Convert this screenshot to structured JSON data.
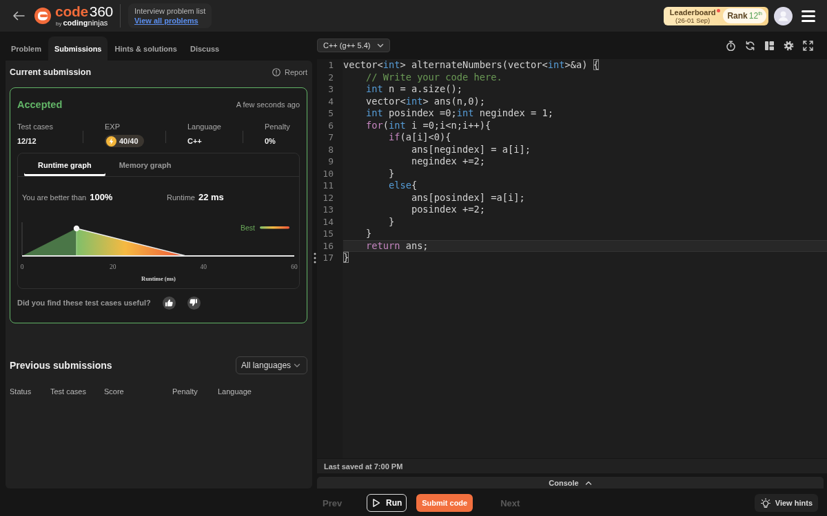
{
  "header": {
    "logo": {
      "accent": "code",
      "number": "360",
      "by": "by",
      "brand": "**coding**ninjas"
    },
    "breadcrumb": {
      "title": "Interview problem list",
      "link": "View all problems"
    },
    "leaderboard": {
      "label": "Leaderboard",
      "period": "(26-01 Sep)",
      "unread": true,
      "rank_label": "Rank",
      "rank": "12$^{th}$"
    }
  },
  "tabs": [
    {
      "label": "Problem",
      "selected": false
    },
    {
      "label": "Submissions",
      "selected": true
    },
    {
      "label": "Hints & solutions",
      "selected": false
    },
    {
      "label": "Discuss",
      "selected": false
    }
  ],
  "submission": {
    "title": "Current submission",
    "report": "Report",
    "result": {
      "status": "Accepted",
      "kind": "accepted",
      "time": "A few seconds ago",
      "stats": [
        {
          "label": "Test cases",
          "value": "12/12",
          "kind": "text"
        },
        {
          "label": "EXP",
          "value": "40/40",
          "kind": "exp"
        },
        {
          "label": "Language",
          "value": "C++",
          "kind": "text"
        },
        {
          "label": "Penalty",
          "value": "0%",
          "kind": "text"
        }
      ],
      "graph": {
        "tabs": [
          {
            "label": "Runtime graph",
            "selected": true
          },
          {
            "label": "Memory graph",
            "selected": false
          }
        ],
        "better_label": "You are better than",
        "better_value": "100%",
        "runtime_label": "Runtime",
        "runtime_value": "22 ms",
        "legend": "Best",
        "x_ticks": [
          "0",
          "20",
          "40",
          "60"
        ],
        "x_label": "Runtime (ms)"
      },
      "feedback": "Did you find these test cases useful?"
    }
  },
  "previous": {
    "title": "Previous submissions",
    "filter": "All languages",
    "columns": [
      "Status",
      "Test cases",
      "Score",
      "Penalty",
      "Language"
    ]
  },
  "editor": {
    "language": "C++ (g++ 5.4)",
    "lines": [
      {
        "number": "1",
        "current": false,
        "tokens": [
          {
            "text": "vector<",
            "kind": "plain"
          },
          {
            "text": "int",
            "kind": "type"
          },
          {
            "text": "> alternateNumbers(vector<",
            "kind": "plain"
          },
          {
            "text": "int",
            "kind": "type"
          },
          {
            "text": ">&a) ",
            "kind": "plain"
          },
          {
            "text": "{",
            "kind": "bracket"
          }
        ]
      },
      {
        "number": "2",
        "current": false,
        "tokens": [
          {
            "text": "    // Write your code here.",
            "kind": "comment"
          }
        ]
      },
      {
        "number": "3",
        "current": false,
        "tokens": [
          {
            "text": "    int",
            "kind": "type"
          },
          {
            "text": " n = a.size();",
            "kind": "plain"
          }
        ]
      },
      {
        "number": "4",
        "current": false,
        "tokens": [
          {
            "text": "    vector<",
            "kind": "plain"
          },
          {
            "text": "int",
            "kind": "type"
          },
          {
            "text": "> ans(n,0);",
            "kind": "plain"
          }
        ]
      },
      {
        "number": "5",
        "current": false,
        "tokens": [
          {
            "text": "    int",
            "kind": "type"
          },
          {
            "text": " posindex =0;",
            "kind": "plain"
          },
          {
            "text": "int",
            "kind": "type"
          },
          {
            "text": " negindex = 1;",
            "kind": "plain"
          }
        ]
      },
      {
        "number": "6",
        "current": false,
        "tokens": [
          {
            "text": "    for",
            "kind": "control"
          },
          {
            "text": "(",
            "kind": "plain"
          },
          {
            "text": "int",
            "kind": "type"
          },
          {
            "text": " i =0;i<n;i++){",
            "kind": "plain"
          }
        ]
      },
      {
        "number": "7",
        "current": false,
        "tokens": [
          {
            "text": "        if",
            "kind": "control"
          },
          {
            "text": "(a[i]<0){",
            "kind": "plain"
          }
        ]
      },
      {
        "number": "8",
        "current": false,
        "tokens": [
          {
            "text": "            ans[negindex] = a[i];",
            "kind": "plain"
          }
        ]
      },
      {
        "number": "9",
        "current": false,
        "tokens": [
          {
            "text": "            negindex +=2;",
            "kind": "plain"
          }
        ]
      },
      {
        "number": "10",
        "current": false,
        "tokens": [
          {
            "text": "        }",
            "kind": "plain"
          }
        ]
      },
      {
        "number": "11",
        "current": false,
        "tokens": [
          {
            "text": "        else",
            "kind": "type"
          },
          {
            "text": "{",
            "kind": "plain"
          }
        ]
      },
      {
        "number": "12",
        "current": false,
        "tokens": [
          {
            "text": "            ans[posindex] =a[i];",
            "kind": "plain"
          }
        ]
      },
      {
        "number": "13",
        "current": false,
        "tokens": [
          {
            "text": "            posindex +=2;",
            "kind": "plain"
          }
        ]
      },
      {
        "number": "14",
        "current": false,
        "tokens": [
          {
            "text": "        }",
            "kind": "plain"
          }
        ]
      },
      {
        "number": "15",
        "current": false,
        "tokens": [
          {
            "text": "    }",
            "kind": "plain"
          }
        ]
      },
      {
        "number": "16",
        "current": true,
        "tokens": [
          {
            "text": "    return",
            "kind": "control"
          },
          {
            "text": " ans;",
            "kind": "plain"
          }
        ]
      },
      {
        "number": "17",
        "current": false,
        "tokens": [
          {
            "text": "}",
            "kind": "bracket"
          }
        ]
      }
    ],
    "saved": "Last saved at 7:00 PM",
    "console": "Console"
  },
  "actions": {
    "buttons": [
      {
        "label": "Prev",
        "kind": "text",
        "disabled": true
      },
      {
        "label": "Run",
        "kind": "outline",
        "disabled": false
      },
      {
        "label": "Submit code",
        "kind": "primary",
        "disabled": false
      },
      {
        "label": "Next",
        "kind": "text",
        "disabled": true
      }
    ],
    "hints": "View hints"
  }
}
